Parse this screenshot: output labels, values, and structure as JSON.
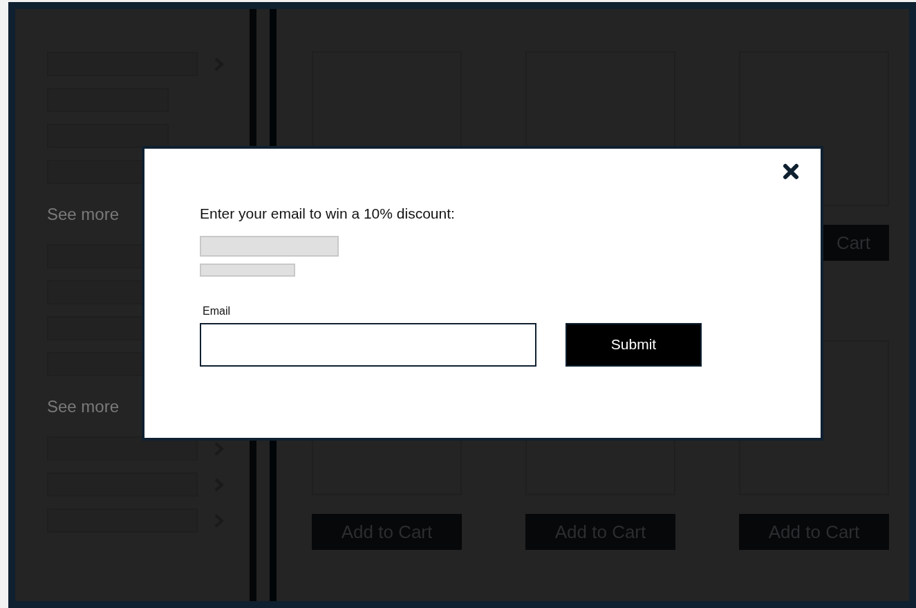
{
  "sidebar": {
    "groups": [
      {
        "items": [
          {
            "has_chevron": true
          },
          {
            "has_chevron": false
          },
          {
            "has_chevron": false
          },
          {
            "has_chevron": false
          }
        ],
        "see_more": "See more"
      },
      {
        "items": [
          {
            "has_chevron": false
          },
          {
            "has_chevron": false
          },
          {
            "has_chevron": false
          },
          {
            "has_chevron": false
          }
        ],
        "see_more": "See more"
      },
      {
        "items": [
          {
            "has_chevron": true
          },
          {
            "has_chevron": true
          },
          {
            "has_chevron": true
          }
        ]
      }
    ]
  },
  "product_rows": [
    [
      {},
      {},
      {
        "button": "Cart"
      }
    ],
    [
      {
        "button": "Add to Cart"
      },
      {
        "button": "Add to Cart"
      },
      {
        "button": "Add to Cart"
      }
    ]
  ],
  "modal": {
    "prompt": "Enter your email to win a 10% discount:",
    "email_label": "Email",
    "submit": "Submit"
  }
}
